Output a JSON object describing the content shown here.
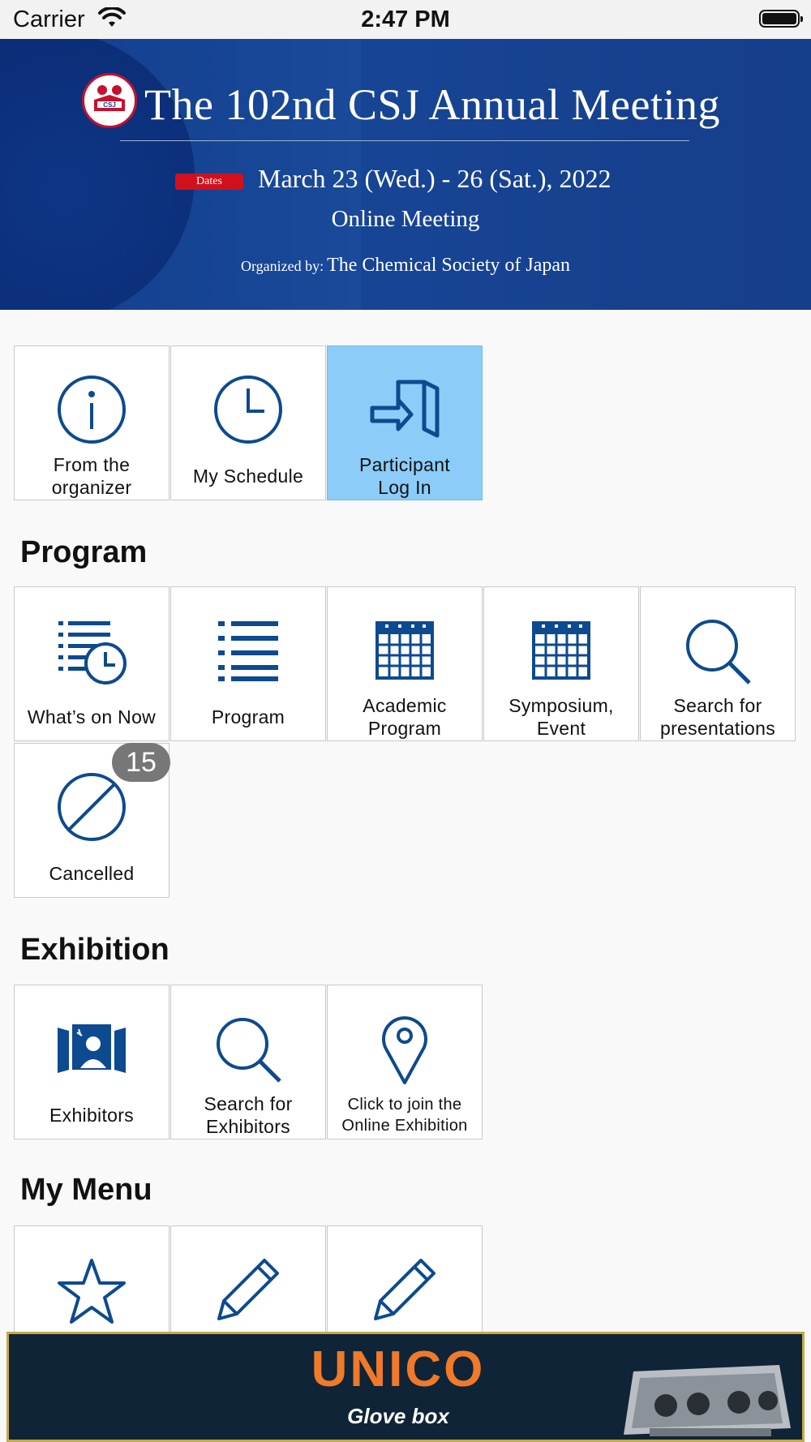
{
  "status_bar": {
    "carrier": "Carrier",
    "time": "2:47 PM"
  },
  "banner": {
    "title": "The 102nd CSJ Annual Meeting",
    "dates_badge": "Dates",
    "dates": "March 23 (Wed.) - 26 (Sat.), 2022",
    "format": "Online Meeting",
    "organized_by_label": "Organized by:",
    "organizer": "The Chemical Society of Japan"
  },
  "top_tiles": [
    {
      "line1": "From the",
      "line2": "organizer",
      "icon": "info-icon"
    },
    {
      "line1": "My Schedule",
      "line2": "",
      "icon": "clock-icon"
    },
    {
      "line1": "Participant",
      "line2": "Log In",
      "icon": "login-icon",
      "active": true
    }
  ],
  "program": {
    "title": "Program",
    "tiles": [
      {
        "line1": "What’s on Now",
        "line2": "",
        "icon": "list-clock-icon"
      },
      {
        "line1": "Program",
        "line2": "",
        "icon": "list-icon"
      },
      {
        "line1": "Academic",
        "line2": "Program",
        "icon": "calendar-icon"
      },
      {
        "line1": "Symposium,",
        "line2": "Event",
        "icon": "calendar-icon"
      },
      {
        "line1": "Search for",
        "line2": "presentations",
        "icon": "search-icon"
      },
      {
        "line1": "Cancelled",
        "line2": "",
        "icon": "cancel-icon",
        "badge": "15"
      }
    ]
  },
  "exhibition": {
    "title": "Exhibition",
    "tiles": [
      {
        "line1": "Exhibitors",
        "line2": "",
        "icon": "exhibitor-booth-icon"
      },
      {
        "line1": "Search for",
        "line2": "Exhibitors",
        "icon": "search-icon"
      },
      {
        "line1": "Click to join the",
        "line2": "Online Exhibition",
        "icon": "map-pin-icon"
      }
    ]
  },
  "my_menu": {
    "title": "My Menu",
    "tiles": [
      {
        "icon": "star-icon"
      },
      {
        "icon": "pencil-icon"
      },
      {
        "icon": "pencil-icon"
      }
    ]
  },
  "ad": {
    "brand": "UNICO",
    "subtitle": "Glove box"
  },
  "colors": {
    "icon_blue": "#0d4a8f",
    "active_tile": "#8bcdf8",
    "banner_blue": "#1a4a9a"
  }
}
